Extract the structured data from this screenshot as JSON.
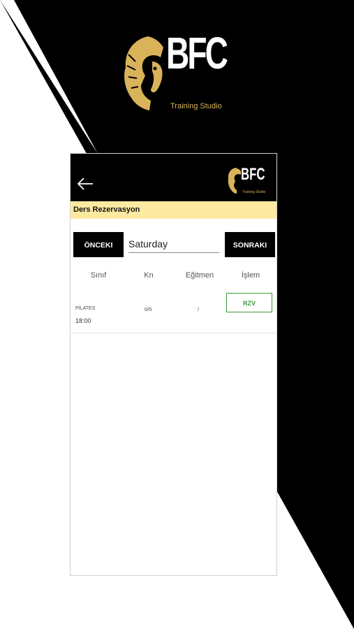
{
  "hero": {
    "logo_text": "BFC",
    "logo_subtext": "Training Studio"
  },
  "appbar": {
    "back_icon": "arrow-left-icon",
    "logo_text": "BFC",
    "logo_subtext": "Training Studio"
  },
  "section": {
    "title": "Ders Rezervasyon"
  },
  "day_nav": {
    "prev_label": "ÖNCEKI",
    "next_label": "SONRAKI",
    "day_value": "Saturday"
  },
  "table": {
    "headers": [
      "Sınıf",
      "Kn",
      "Eğitmen",
      "İşlem"
    ],
    "rows": [
      {
        "class_name": "PİLATES",
        "time": "18:00",
        "kn": "0/5",
        "trainer": "/",
        "action_label": "RZV"
      }
    ]
  },
  "colors": {
    "black": "#000000",
    "accent_yellow": "#fde9a0",
    "gold": "#d8b35a",
    "action_green": "#3c9a3c"
  }
}
